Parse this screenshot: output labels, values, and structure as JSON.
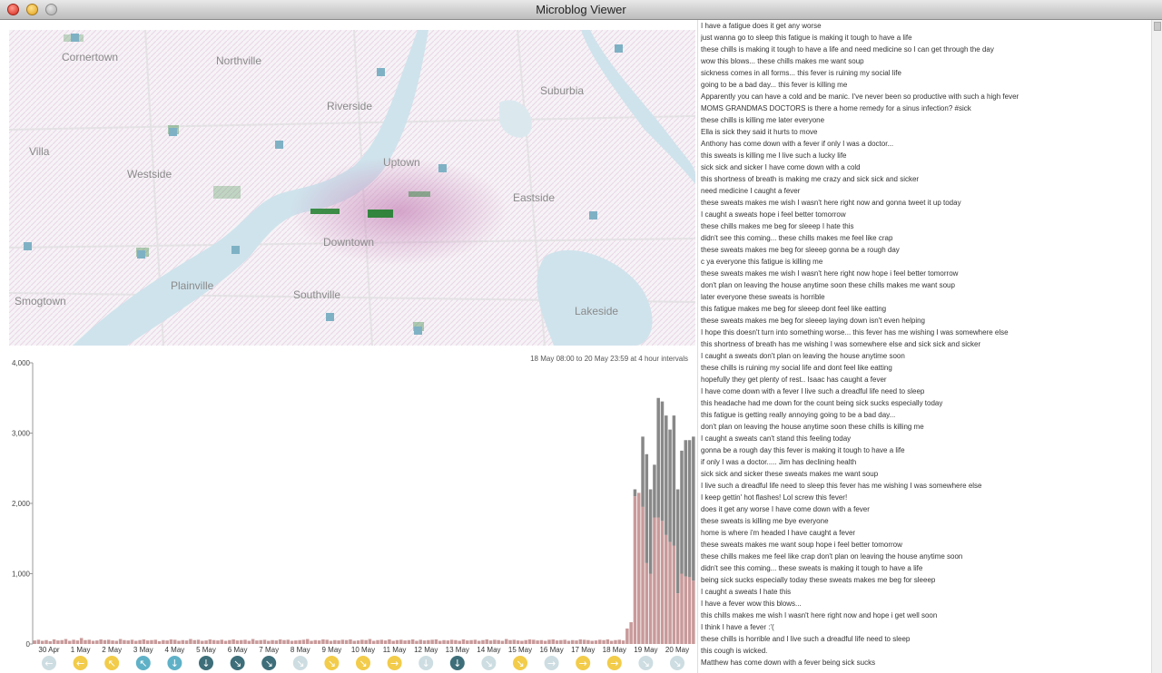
{
  "window": {
    "title": "Microblog Viewer"
  },
  "map": {
    "places": [
      {
        "name": "Cornertown"
      },
      {
        "name": "Northville"
      },
      {
        "name": "Suburbia"
      },
      {
        "name": "Riverside"
      },
      {
        "name": "Villa"
      },
      {
        "name": "Uptown"
      },
      {
        "name": "Westside"
      },
      {
        "name": "Eastside"
      },
      {
        "name": "Downtown"
      },
      {
        "name": "Plainville"
      },
      {
        "name": "Southville"
      },
      {
        "name": "Smogtown"
      },
      {
        "name": "Lakeside"
      }
    ],
    "colors": {
      "water": "#cfe3ec",
      "road": "#e6e6e6",
      "heat_pink": "#d3a6c9",
      "heat_green": "#2f9a3a"
    }
  },
  "chart_data": {
    "type": "bar",
    "interval_label": "18 May 08:00 to 20 May 23:59 at 4 hour intervals",
    "ylim": [
      0,
      4000
    ],
    "yticks": [
      "0",
      "1,000",
      "2,000",
      "3,000",
      "4,000"
    ],
    "xticks": [
      "30 Apr",
      "1 May",
      "2 May",
      "3 May",
      "4 May",
      "5 May",
      "6 May",
      "7 May",
      "8 May",
      "9 May",
      "10 May",
      "11 May",
      "12 May",
      "13 May",
      "14 May",
      "15 May",
      "16 May",
      "17 May",
      "18 May",
      "19 May",
      "20 May"
    ],
    "series": [
      {
        "color": "#c99a9a",
        "values": [
          50,
          60,
          45,
          55,
          40,
          65,
          50,
          55,
          70,
          45,
          60,
          50,
          85,
          55,
          60,
          45,
          50,
          65,
          55,
          60,
          50,
          45,
          70,
          55,
          50,
          60,
          45,
          55,
          65,
          50,
          55,
          60,
          40,
          55,
          50,
          65,
          60,
          45,
          55,
          50,
          70,
          55,
          60,
          45,
          50,
          65,
          55,
          50,
          60,
          45,
          55,
          65,
          50,
          55,
          60,
          45,
          70,
          50,
          55,
          60,
          45,
          55,
          50,
          65,
          55,
          60,
          45,
          50,
          55,
          60,
          70,
          45,
          55,
          50,
          65,
          60,
          45,
          55,
          50,
          60,
          55,
          65,
          45,
          50,
          60,
          55,
          70,
          45,
          55,
          60,
          50,
          65,
          45,
          55,
          60,
          50,
          55,
          65,
          45,
          60,
          50,
          55,
          60,
          65,
          45,
          55,
          50,
          60,
          55,
          45,
          65,
          50,
          55,
          60,
          45,
          55,
          65,
          50,
          60,
          55,
          45,
          70,
          55,
          60,
          50,
          45,
          55,
          65,
          60,
          50,
          55,
          45,
          60,
          65,
          50,
          55,
          60,
          45,
          55,
          50,
          65,
          60,
          55,
          45,
          50,
          60,
          55,
          65,
          45,
          55,
          60,
          50,
          220,
          310,
          2100,
          2150,
          1950,
          1150,
          1000,
          1800,
          1800,
          1750,
          1550,
          1450,
          1400,
          720,
          1000,
          960,
          950,
          900
        ]
      },
      {
        "color": "#888888",
        "values": [
          50,
          60,
          45,
          55,
          40,
          65,
          50,
          55,
          70,
          45,
          60,
          50,
          85,
          55,
          60,
          45,
          50,
          65,
          55,
          60,
          50,
          45,
          70,
          55,
          50,
          60,
          45,
          55,
          65,
          50,
          55,
          60,
          40,
          55,
          50,
          65,
          60,
          45,
          55,
          50,
          70,
          55,
          60,
          45,
          50,
          65,
          55,
          50,
          60,
          45,
          55,
          65,
          50,
          55,
          60,
          45,
          70,
          50,
          55,
          60,
          45,
          55,
          50,
          65,
          55,
          60,
          45,
          50,
          55,
          60,
          70,
          45,
          55,
          50,
          65,
          60,
          45,
          55,
          50,
          60,
          55,
          65,
          45,
          50,
          60,
          55,
          70,
          45,
          55,
          60,
          50,
          65,
          45,
          55,
          60,
          50,
          55,
          65,
          45,
          60,
          50,
          55,
          60,
          65,
          45,
          55,
          50,
          60,
          55,
          45,
          65,
          50,
          55,
          60,
          45,
          55,
          65,
          50,
          60,
          55,
          45,
          70,
          55,
          60,
          50,
          45,
          55,
          65,
          60,
          50,
          55,
          45,
          60,
          65,
          50,
          55,
          60,
          45,
          55,
          50,
          65,
          60,
          55,
          45,
          50,
          60,
          55,
          65,
          45,
          55,
          60,
          50,
          220,
          310,
          2200,
          2150,
          2950,
          2700,
          2200,
          2550,
          3500,
          3450,
          3250,
          3050,
          3250,
          2200,
          2750,
          2900,
          2900,
          2950
        ]
      }
    ],
    "weather": [
      {
        "icon": "arrow-left-icon",
        "color": "#cddde2",
        "glyph": "←"
      },
      {
        "icon": "arrow-left-icon",
        "color": "#f2cc4a",
        "glyph": "←"
      },
      {
        "icon": "arrow-up-left-icon",
        "color": "#f2cc4a",
        "glyph": "↖"
      },
      {
        "icon": "arrow-up-left-icon",
        "color": "#5fb1c7",
        "glyph": "↖"
      },
      {
        "icon": "arrow-down-icon",
        "color": "#5fb1c7",
        "glyph": "↓"
      },
      {
        "icon": "arrow-down-icon",
        "color": "#3d6e79",
        "glyph": "↓"
      },
      {
        "icon": "arrow-down-right-icon",
        "color": "#3d6e79",
        "glyph": "↘"
      },
      {
        "icon": "arrow-down-right-icon",
        "color": "#3d6e79",
        "glyph": "↘"
      },
      {
        "icon": "arrow-down-right-icon",
        "color": "#cddde2",
        "glyph": "↘"
      },
      {
        "icon": "arrow-down-right-icon",
        "color": "#f2cc4a",
        "glyph": "↘"
      },
      {
        "icon": "arrow-down-right-icon",
        "color": "#f2cc4a",
        "glyph": "↘"
      },
      {
        "icon": "arrow-right-icon",
        "color": "#f2cc4a",
        "glyph": "→"
      },
      {
        "icon": "arrow-down-icon",
        "color": "#cddde2",
        "glyph": "↓"
      },
      {
        "icon": "arrow-down-icon",
        "color": "#3d6e79",
        "glyph": "↓"
      },
      {
        "icon": "arrow-down-right-icon",
        "color": "#cddde2",
        "glyph": "↘"
      },
      {
        "icon": "arrow-down-right-icon",
        "color": "#f2cc4a",
        "glyph": "↘"
      },
      {
        "icon": "arrow-right-icon",
        "color": "#cddde2",
        "glyph": "→"
      },
      {
        "icon": "arrow-right-icon",
        "color": "#f2cc4a",
        "glyph": "→"
      },
      {
        "icon": "arrow-right-icon",
        "color": "#f2cc4a",
        "glyph": "→"
      },
      {
        "icon": "arrow-down-right-icon",
        "color": "#cddde2",
        "glyph": "↘"
      },
      {
        "icon": "arrow-down-right-icon",
        "color": "#cddde2",
        "glyph": "↘"
      }
    ]
  },
  "feed": {
    "messages": [
      "I have a fatigue does it get any worse",
      "just wanna go to sleep this fatigue is making it tough to have a life",
      "these chills is making it tough to have a life and need medicine so I can get through the day",
      "wow this blows... these chills makes me want soup",
      "sickness comes in all forms... this fever is ruining my social life",
      "going to be a bad day... this fever is killing me",
      "Apparently you can have a cold and be manic. I've never been so productive with such a high fever",
      "MOMS GRANDMAS DOCTORS is there a home remedy for a sinus infection? #sick",
      "these chills is killing me later everyone",
      "Ella is sick they said it hurts to move",
      "Anthony has come down with a fever if only I was a doctor...",
      "this sweats is killing me I live such a lucky life",
      "sick sick and sicker I have come down with a cold",
      "this shortness of breath is making me crazy and sick sick and sicker",
      "need medicine I caught a fever",
      "these sweats makes me wish I wasn't here right now and gonna tweet it up today",
      "I caught a sweats hope i feel better tomorrow",
      "these chills makes me beg for sleeep I hate this",
      "didn't see this coming... these chills makes me feel like crap",
      "these sweats makes me beg for sleeep gonna be a rough day",
      "c ya everyone this fatigue is killing me",
      "these sweats makes me wish I wasn't here right now hope i feel better tomorrow",
      "don't plan on leaving the house anytime soon these chills makes me want soup",
      "later everyone these sweats is horrible",
      "this fatigue makes me beg for sleeep dont feel like eatting",
      "these sweats makes me beg for sleeep laying down isn't even helping",
      "I hope this doesn't turn into something worse... this fever has me wishing I was somewhere else",
      "this shortness of breath has me wishing I was somewhere else and sick sick and sicker",
      "I caught a sweats don't plan on leaving the house anytime soon",
      "these chills is ruining my social life and dont feel like eatting",
      "hopefully they get plenty of rest.. Isaac has caught a fever",
      "I have come down with a fever I live such a dreadful life need to sleep",
      "this headache had me down for the count being sick sucks especially today",
      "this fatigue is getting really annoying going to be a bad day...",
      "don't plan on leaving the house anytime soon these chills is killing me",
      "I caught a sweats can't stand this feeling today",
      "gonna be a rough day this fever is making it tough to have a life",
      "if only I was a doctor..... Jim has declining health",
      "sick sick and sicker these sweats makes me want soup",
      "I live such a dreadful life need to sleep this fever has me wishing I was somewhere else",
      "I keep gettin' hot flashes! Lol screw this fever!",
      "does it get any worse I have come down with a fever",
      "these sweats is killing me bye everyone",
      "home is where i'm headed I have caught a fever",
      "these sweats makes me want soup hope i feel better tomorrow",
      "these chills makes me feel like crap don't plan on leaving the house anytime soon",
      "didn't see this coming... these sweats is making it tough to have a life",
      "being sick sucks especially today these sweats makes me beg for sleeep",
      "I caught a sweats I hate this",
      "I have a fever wow this blows...",
      "this chills makes me wish I wasn't here right now and hope i get well soon",
      "I think I have a fever :'(",
      "these chills is horrible and I live such a dreadful life need to sleep",
      "this cough is wicked.",
      "Matthew has come down with a fever being sick sucks"
    ]
  }
}
